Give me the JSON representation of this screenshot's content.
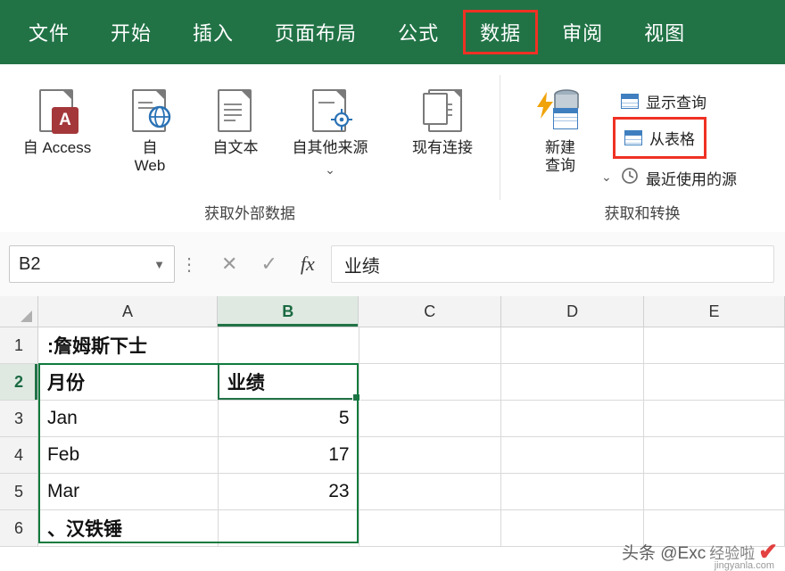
{
  "ribbon": {
    "tabs": [
      {
        "label": "文件",
        "active": false,
        "highlight": false
      },
      {
        "label": "开始",
        "active": false,
        "highlight": false
      },
      {
        "label": "插入",
        "active": false,
        "highlight": false
      },
      {
        "label": "页面布局",
        "active": false,
        "highlight": false
      },
      {
        "label": "公式",
        "active": false,
        "highlight": false
      },
      {
        "label": "数据",
        "active": true,
        "highlight": true
      },
      {
        "label": "审阅",
        "active": false,
        "highlight": false
      },
      {
        "label": "视图",
        "active": false,
        "highlight": false
      }
    ],
    "groups": [
      {
        "label": "获取外部数据"
      },
      {
        "label": "获取和转换"
      }
    ],
    "buttons": [
      {
        "name": "from-access",
        "caption": "自 Access",
        "icon": "access-icon"
      },
      {
        "name": "from-web",
        "caption": "自\nWeb",
        "icon": "globe-icon"
      },
      {
        "name": "from-text",
        "caption": "自文本",
        "icon": "text-file-icon"
      },
      {
        "name": "from-other-sources",
        "caption": "自其他来源",
        "icon": "other-sources-icon"
      },
      {
        "name": "existing-connections",
        "caption": "现有连接",
        "icon": "connections-icon"
      },
      {
        "name": "new-query",
        "caption": "新建\n查询",
        "icon": "new-query-icon"
      }
    ],
    "small_buttons": [
      {
        "name": "show-queries",
        "label": "显示查询",
        "icon": "queries-icon",
        "highlight": false
      },
      {
        "name": "from-table",
        "label": "从表格",
        "icon": "table-icon",
        "highlight": true
      },
      {
        "name": "recent-sources",
        "label": "最近使用的源",
        "icon": "recent-icon",
        "highlight": false
      }
    ]
  },
  "formula_bar": {
    "name_box": "B2",
    "cancel_icon": "close-icon",
    "confirm_icon": "check-icon",
    "function_icon": "fx",
    "value": "业绩"
  },
  "sheet": {
    "columns": [
      "A",
      "B",
      "C",
      "D",
      "E"
    ],
    "selected_column": "B",
    "row_headers": [
      "1",
      "2",
      "3",
      "4",
      "5",
      "6"
    ],
    "selected_row": "2",
    "rows": [
      {
        "A": ":詹姆斯下士",
        "B": "",
        "C": "",
        "D": "",
        "E": "",
        "bold": true
      },
      {
        "A": "月份",
        "B": "业绩",
        "C": "",
        "D": "",
        "E": "",
        "bold": true
      },
      {
        "A": "Jan",
        "B": "5",
        "C": "",
        "D": "",
        "E": "",
        "bold": false
      },
      {
        "A": "Feb",
        "B": "17",
        "C": "",
        "D": "",
        "E": "",
        "bold": false
      },
      {
        "A": "Mar",
        "B": "23",
        "C": "",
        "D": "",
        "E": "",
        "bold": false
      },
      {
        "A": "、汉铁锤",
        "B": "",
        "C": "",
        "D": "",
        "E": "",
        "bold": true
      }
    ]
  },
  "watermark": {
    "prefix": "头条 @Exc",
    "middle": "经验啦",
    "mark": "✔",
    "site": "jingyanla.com"
  },
  "colors": {
    "excel_green": "#217346",
    "highlight_red": "#ef3124",
    "selection_green": "#0f7a3d"
  }
}
